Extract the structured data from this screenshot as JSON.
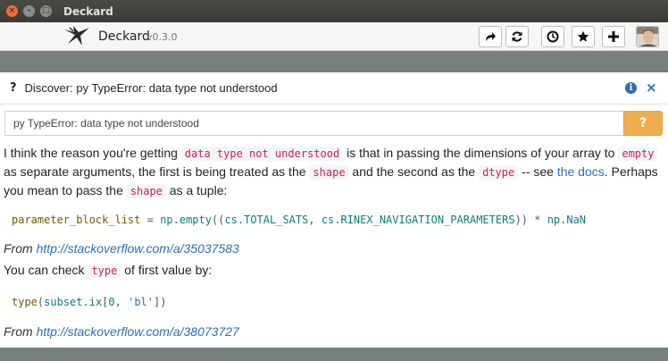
{
  "window": {
    "title": "Deckard",
    "controls": {
      "close": "×",
      "minimize": "–",
      "maximize": "□"
    }
  },
  "app": {
    "name": "Deckard",
    "version": "v0.3.0",
    "toolbar": [
      {
        "name": "share",
        "icon": "share-icon"
      },
      {
        "name": "refresh",
        "icon": "refresh-icon"
      },
      {
        "name": "history",
        "icon": "clock-icon"
      },
      {
        "name": "favorite",
        "icon": "star-icon"
      },
      {
        "name": "add",
        "icon": "plus-icon"
      }
    ]
  },
  "discover": {
    "prefix": "?",
    "title": "Discover: py TypeError: data type not understood",
    "info": "i",
    "close": "×",
    "search_value": "py TypeError: data type not understood",
    "search_button": "?"
  },
  "answer": {
    "p1_a": "I think the reason you're getting ",
    "p1_code1": "data type not understood",
    "p1_b": " is that in passing the dimensions of your array to ",
    "p1_code2": "empty",
    "p1_c": " as separate arguments, the first is being treated as the ",
    "p1_code3": "shape",
    "p1_d": " and the second as the ",
    "p1_code4": "dtype",
    "p1_e": " -- see ",
    "p1_link": "the docs",
    "p1_f": ". Perhaps you mean to pass the ",
    "p1_code5": "shape",
    "p1_g": " as a tuple:",
    "code1": {
      "t1": "parameter_block_list",
      "t2": " = ",
      "t3": "np.empty",
      "t4": "((",
      "t5": "cs.TOTAL_SATS",
      "t6": ", ",
      "t7": "cs.RINEX_NAVIGATION_PARAMETERS",
      "t8": ")) * ",
      "t9": "np.NaN"
    },
    "from1_label": "From ",
    "from1_url": "http://stackoverflow.com/a/35037583",
    "p2_a": "You can check ",
    "p2_code": "type",
    "p2_b": " of first value by:",
    "code2": {
      "t1": "type",
      "t2": "(",
      "t3": "subset.ix",
      "t4": "[",
      "t5": "0",
      "t6": ", ",
      "t7": "'bl'",
      "t8": "])"
    },
    "from2_label": "From ",
    "from2_url": "http://stackoverflow.com/a/38073727"
  },
  "colors": {
    "titlebar": "#3c3b37",
    "close_button": "#ee6b3b",
    "accent": "#2a6fb5",
    "search_button": "#f0ad4e",
    "inline_code": "#c7254e",
    "background": "#76817f"
  }
}
